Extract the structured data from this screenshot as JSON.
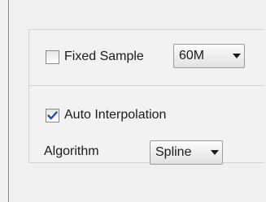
{
  "fixed_sample": {
    "label": "Fixed Sample",
    "checked": false,
    "rate_selected": "60M"
  },
  "interpolation": {
    "label": "Auto Interpolation",
    "checked": true,
    "algorithm_label": "Algorithm",
    "algorithm_selected": "Spline"
  },
  "colors": {
    "check_mark": "#1f4fa6",
    "background": "#f0f0f0",
    "panel_border": "#d2d2d2"
  }
}
